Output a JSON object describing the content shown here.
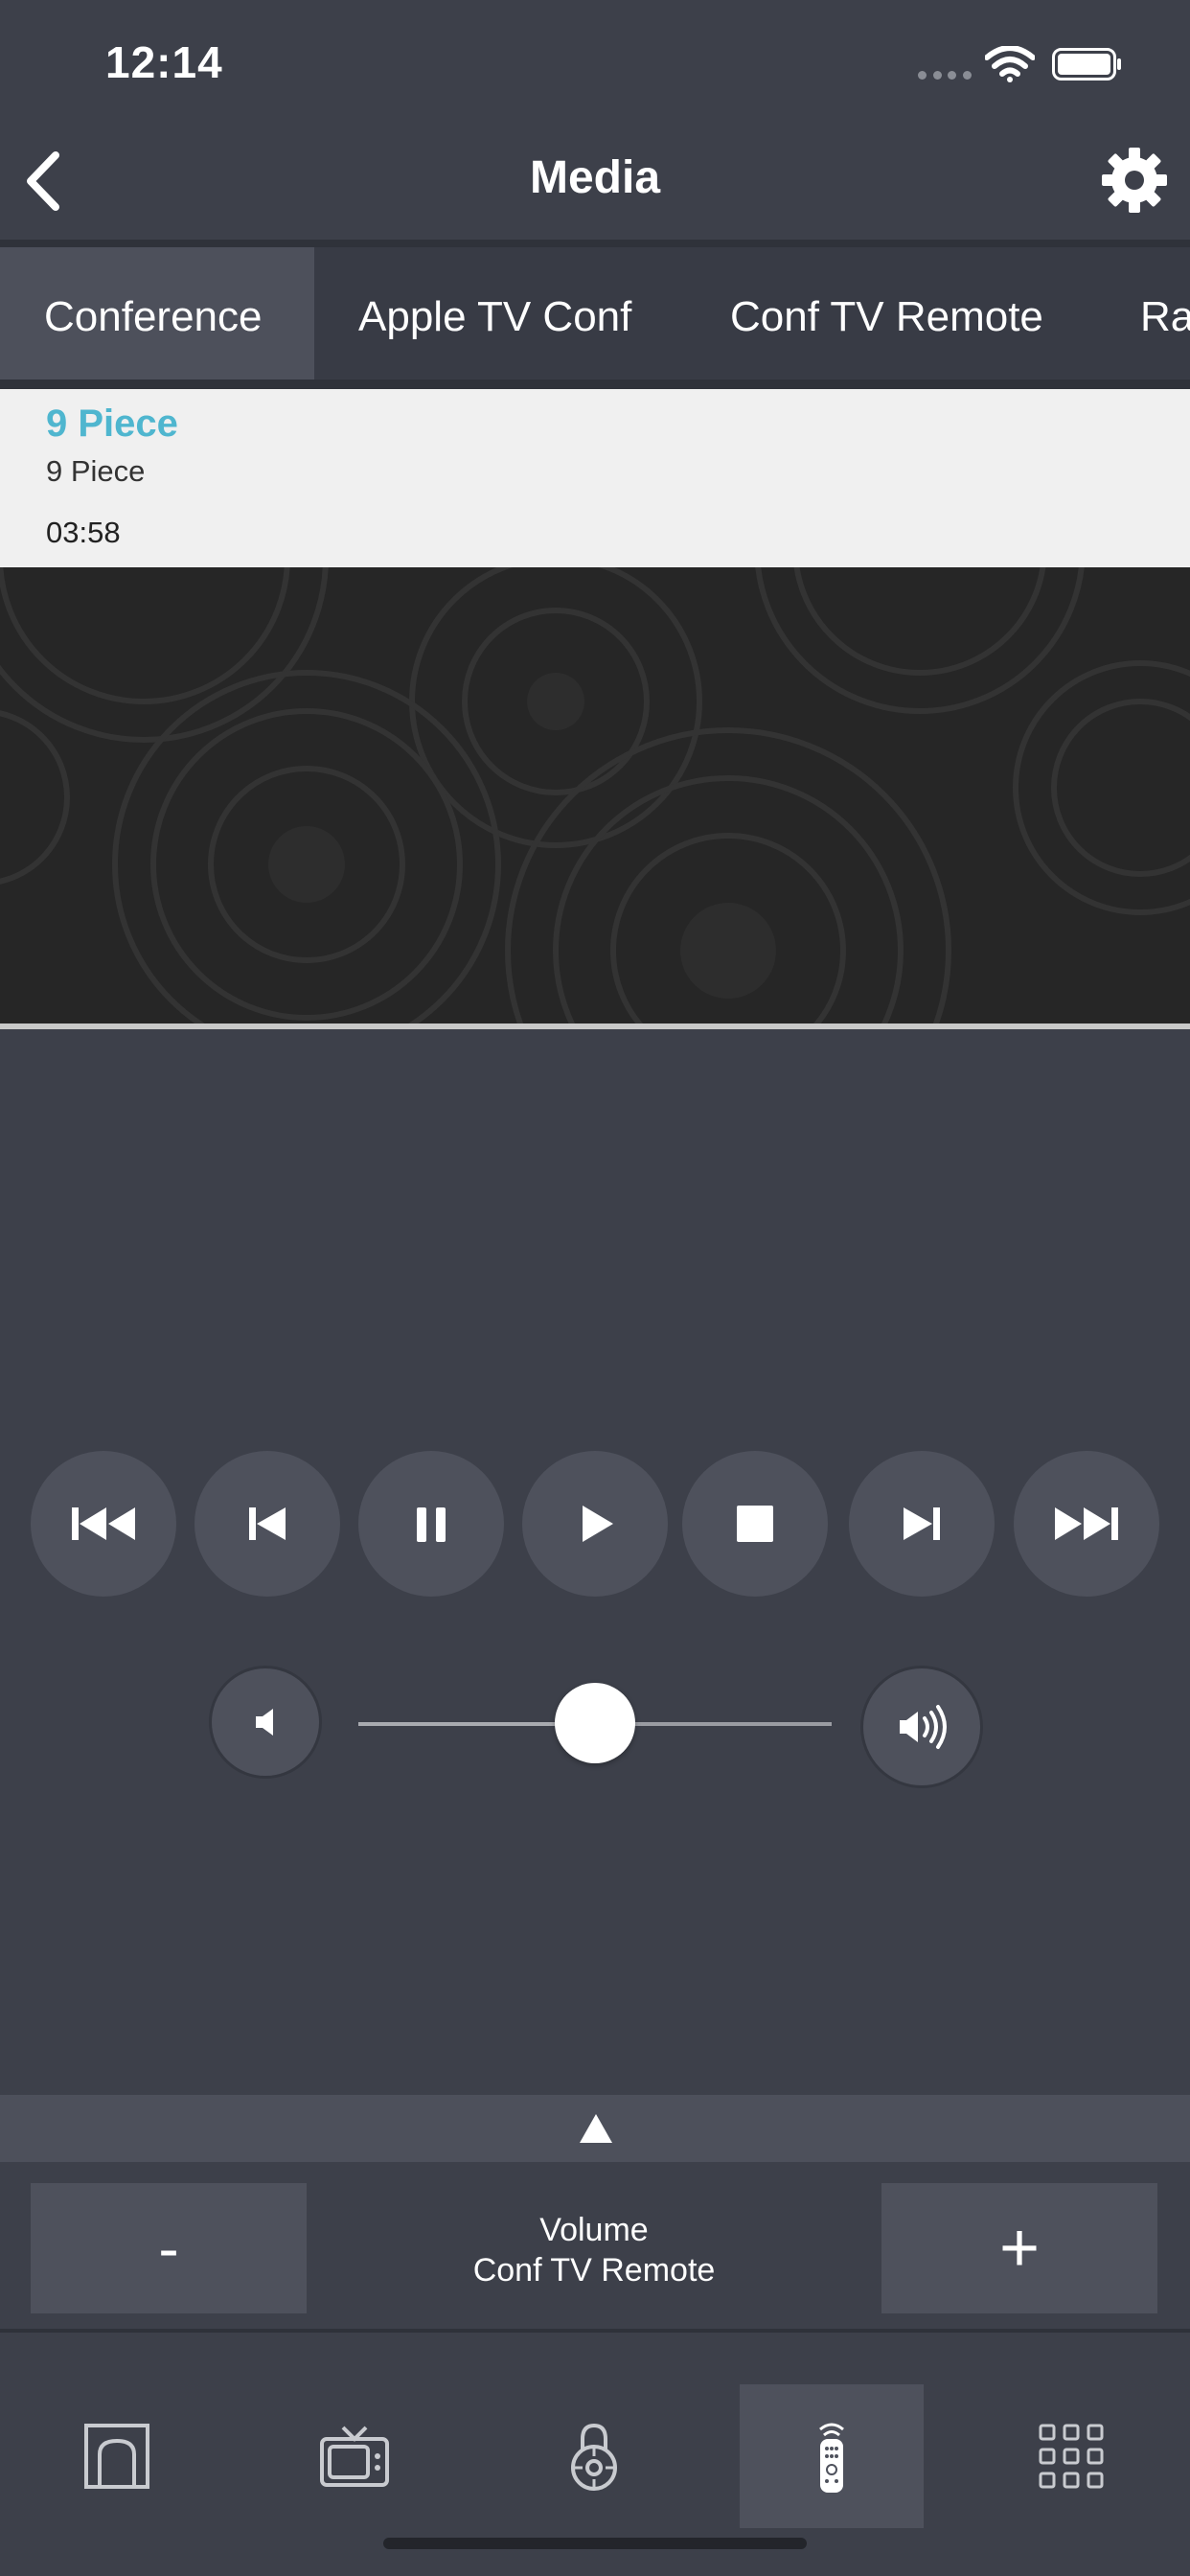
{
  "status_bar": {
    "time": "12:14"
  },
  "nav": {
    "title": "Media",
    "back_icon": "chevron-left-icon",
    "settings_icon": "gear-icon"
  },
  "tabs": [
    {
      "label": "Conference",
      "active": true
    },
    {
      "label": "Apple TV Conf",
      "active": false
    },
    {
      "label": "Conf TV Remote",
      "active": false
    },
    {
      "label": "Ra",
      "active": false
    }
  ],
  "now_playing": {
    "title": "9 Piece",
    "artist": "9 Piece",
    "duration": "03:58"
  },
  "transport": [
    "fast-rewind-icon",
    "skip-previous-icon",
    "pause-icon",
    "play-icon",
    "stop-icon",
    "skip-next-icon",
    "fast-forward-icon"
  ],
  "volume_slider": {
    "level": 0.5
  },
  "volume_panel": {
    "minus_label": "-",
    "plus_label": "+",
    "line1": "Volume",
    "line2": "Conf TV Remote"
  },
  "bottom_tabs": [
    {
      "icon": "home-icon",
      "active": false
    },
    {
      "icon": "tv-icon",
      "active": false
    },
    {
      "icon": "lock-icon",
      "active": false
    },
    {
      "icon": "remote-icon",
      "active": true
    },
    {
      "icon": "grid-icon",
      "active": false
    }
  ],
  "colors": {
    "background": "#3d404a",
    "accent": "#4fb6cf",
    "button": "#4e515c"
  }
}
